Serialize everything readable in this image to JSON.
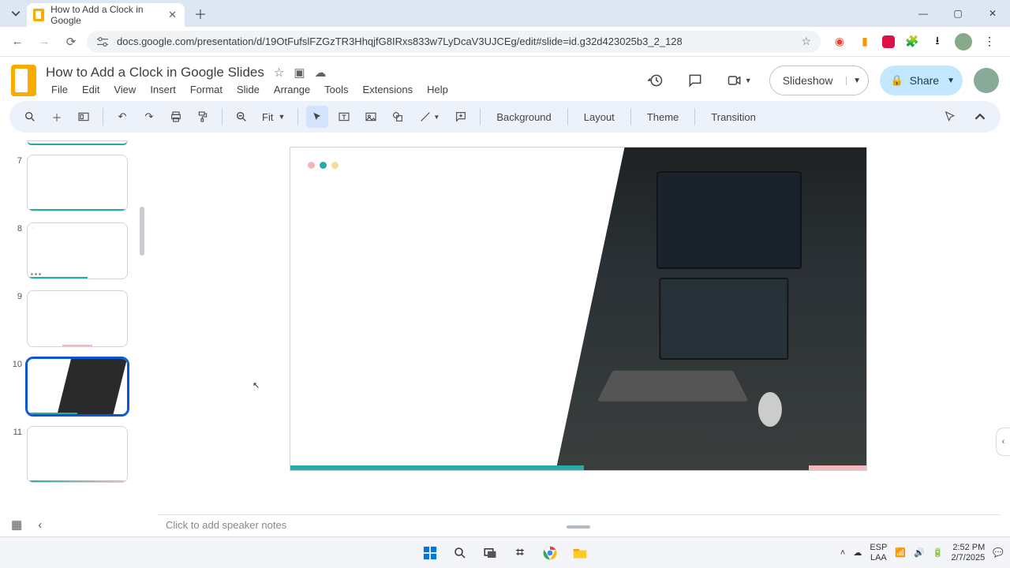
{
  "browser": {
    "tab_title": "How to Add a Clock in Google",
    "url": "docs.google.com/presentation/d/19OtFufslFZGzTR3HhqjfG8IRxs833w7LyDcaV3UJCEg/edit#slide=id.g32d423025b3_2_128"
  },
  "app": {
    "doc_title": "How to Add a Clock in Google Slides",
    "menus": {
      "file": "File",
      "edit": "Edit",
      "view": "View",
      "insert": "Insert",
      "format": "Format",
      "slide": "Slide",
      "arrange": "Arrange",
      "tools": "Tools",
      "extensions": "Extensions",
      "help": "Help"
    },
    "slideshow_label": "Slideshow",
    "share_label": "Share"
  },
  "toolbar": {
    "zoom": "Fit",
    "background": "Background",
    "layout": "Layout",
    "theme": "Theme",
    "transition": "Transition"
  },
  "slides": {
    "n7": "7",
    "n8": "8",
    "n9": "9",
    "n10": "10",
    "n11": "11",
    "selected": 10
  },
  "notes": {
    "placeholder": "Click to add speaker notes"
  },
  "system": {
    "lang_top": "ESP",
    "lang_bot": "LAA",
    "time": "2:52 PM",
    "date": "2/7/2025"
  }
}
